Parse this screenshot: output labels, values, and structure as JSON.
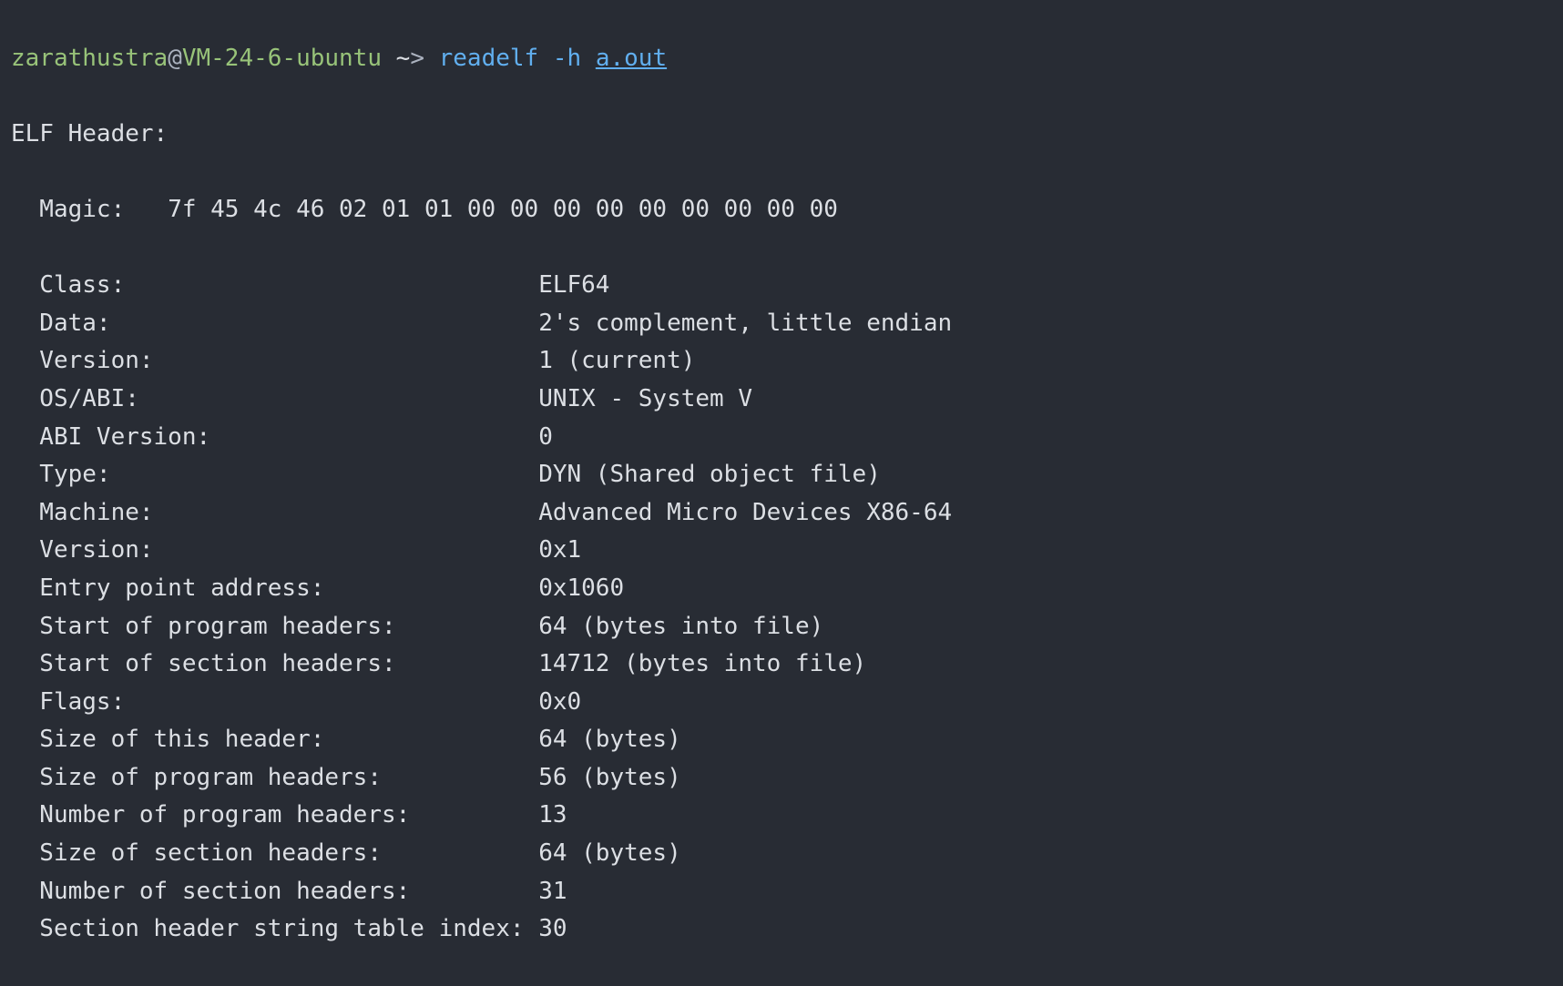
{
  "prompt": {
    "user": "zarathustra",
    "at": "@",
    "host": "VM-24-6-ubuntu",
    "path": " ~",
    "arrow": "> ",
    "command": "readelf",
    "arg": " -h ",
    "file": "a.out"
  },
  "header_title": "ELF Header:",
  "magic_label": "  Magic:   ",
  "magic_value": "7f 45 4c 46 02 01 01 00 00 00 00 00 00 00 00 00 ",
  "fields": [
    {
      "label": "  Class:                             ",
      "value": "ELF64"
    },
    {
      "label": "  Data:                              ",
      "value": "2's complement, little endian"
    },
    {
      "label": "  Version:                           ",
      "value": "1 (current)"
    },
    {
      "label": "  OS/ABI:                            ",
      "value": "UNIX - System V"
    },
    {
      "label": "  ABI Version:                       ",
      "value": "0"
    },
    {
      "label": "  Type:                              ",
      "value": "DYN (Shared object file)"
    },
    {
      "label": "  Machine:                           ",
      "value": "Advanced Micro Devices X86-64"
    },
    {
      "label": "  Version:                           ",
      "value": "0x1"
    },
    {
      "label": "  Entry point address:               ",
      "value": "0x1060"
    },
    {
      "label": "  Start of program headers:          ",
      "value": "64 (bytes into file)"
    },
    {
      "label": "  Start of section headers:          ",
      "value": "14712 (bytes into file)"
    },
    {
      "label": "  Flags:                             ",
      "value": "0x0"
    },
    {
      "label": "  Size of this header:               ",
      "value": "64 (bytes)"
    },
    {
      "label": "  Size of program headers:           ",
      "value": "56 (bytes)"
    },
    {
      "label": "  Number of program headers:         ",
      "value": "13"
    },
    {
      "label": "  Size of section headers:           ",
      "value": "64 (bytes)"
    },
    {
      "label": "  Number of section headers:         ",
      "value": "31"
    },
    {
      "label": "  Section header string table index: ",
      "value": "30"
    }
  ]
}
